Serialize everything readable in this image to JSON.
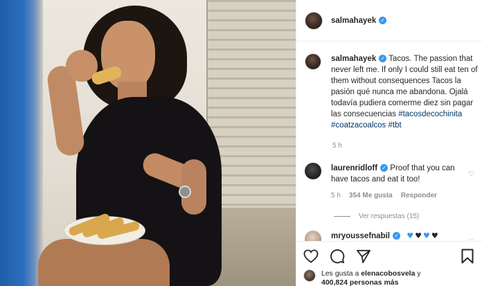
{
  "post": {
    "username": "salmahayek",
    "caption_text": "Tacos. The passion that never left me. If only I could still eat ten of them without consequences Tacos la pasión qué nunca me abandona. Ojalá todavía pudiera comerme diez sin pagar las consecuencias",
    "hashtags": [
      "#tacosdecochinita",
      "#coatzacoalcos",
      "#tbt"
    ],
    "caption_time": "5 h"
  },
  "comments": [
    {
      "username": "laurenridloff",
      "text": "Proof that you can have tacos and eat it too!",
      "time": "5 h",
      "likes": "354 Me gusta",
      "reply": "Responder",
      "view_replies": "Ver respuestas (15)"
    },
    {
      "username": "mryoussefnabil",
      "hearts": [
        "#3897f0",
        "#262626",
        "#3897f0",
        "#262626"
      ]
    }
  ],
  "likes_text": {
    "prefix": "Les gusta a",
    "user": "elenacobosvela",
    "suffix_pre": "y",
    "count": "400,824 personas más"
  },
  "colors": {
    "verified": "#3897f0",
    "hashtag": "#00376b",
    "secondary": "#8e8e8e"
  }
}
